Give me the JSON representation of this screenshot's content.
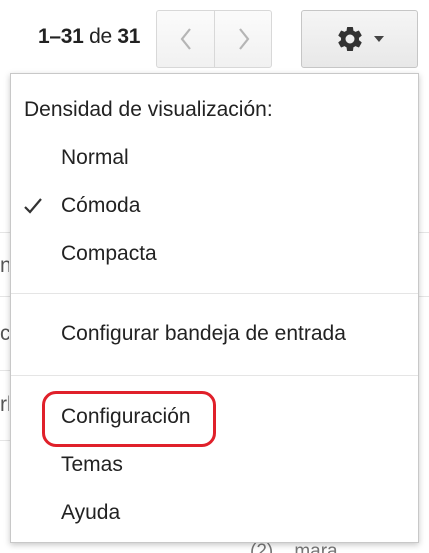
{
  "pager": {
    "range": "1–31",
    "of": "de",
    "total": "31"
  },
  "icons": {
    "prev": "chevron-left-icon",
    "next": "chevron-right-icon",
    "settings": "gear-icon",
    "settings_caret": "caret-down-icon",
    "selected": "checkmark-icon"
  },
  "menu": {
    "density_heading": "Densidad de visualización:",
    "density_options": [
      {
        "label": "Normal",
        "selected": false
      },
      {
        "label": "Cómoda",
        "selected": true
      },
      {
        "label": "Compacta",
        "selected": false
      }
    ],
    "configure_inbox": "Configurar bandeja de entrada",
    "settings": "Configuración",
    "themes": "Temas",
    "help": "Ayuda"
  },
  "background": {
    "row_fragments": [
      "n",
      "c",
      "rl"
    ],
    "bottom_text": "(2) ...mara"
  },
  "colors": {
    "highlight": "#e0202a",
    "border": "#c8c8c8"
  }
}
